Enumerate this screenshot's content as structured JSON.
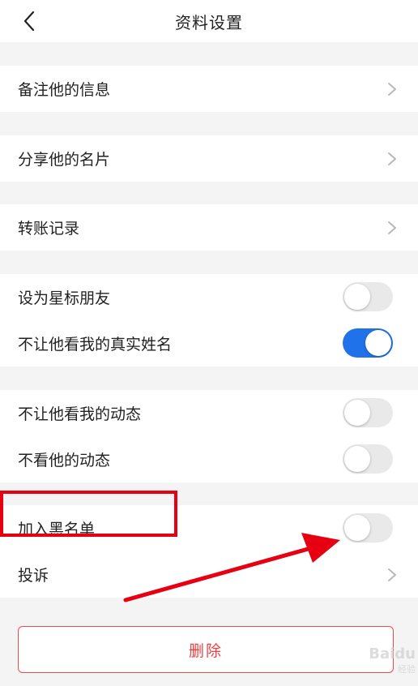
{
  "header": {
    "title": "资料设置"
  },
  "rows": {
    "remark": "备注他的信息",
    "share_card": "分享他的名片",
    "transfer": "转账记录",
    "star": "设为星标朋友",
    "hide_name": "不让他看我的真实姓名",
    "hide_moments": "不让他看我的动态",
    "not_see": "不看他的动态",
    "blacklist": "加入黑名单",
    "complain": "投诉"
  },
  "toggles": {
    "star": false,
    "hide_name": true,
    "hide_moments": false,
    "not_see": false,
    "blacklist": false
  },
  "delete_button": {
    "label": "删除"
  },
  "watermark": {
    "brand": "Baidu",
    "sub": "经验"
  },
  "colors": {
    "accent": "#1f72e9",
    "danger": "#ef3f3f",
    "annotation": "#e60012"
  },
  "icons": {
    "back": "chevron-left-icon",
    "row_arrow": "chevron-right-icon"
  }
}
